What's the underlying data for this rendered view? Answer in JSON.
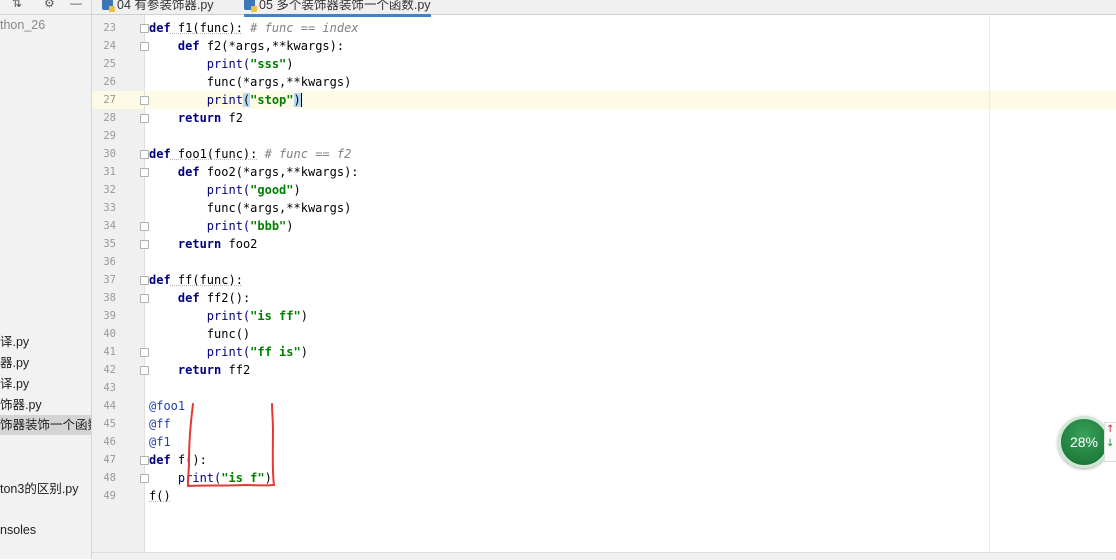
{
  "sidebar": {
    "root_label": "thon_26",
    "items": [
      {
        "label": "译.py",
        "selected": false
      },
      {
        "label": "器.py",
        "selected": false
      },
      {
        "label": "译.py",
        "selected": false
      },
      {
        "label": "饰器.py",
        "selected": false
      },
      {
        "label": "饰器装饰一个函数",
        "selected": true
      },
      {
        "label": "ton3的区别.py",
        "selected": false
      },
      {
        "label": "nsoles",
        "selected": false
      }
    ]
  },
  "tabs": [
    {
      "label": "04 有参装饰器.py",
      "active": false
    },
    {
      "label": "05 多个装饰器装饰一个函数.py",
      "active": true
    }
  ],
  "editor": {
    "line_numbers": [
      "23",
      "24",
      "25",
      "26",
      "27",
      "28",
      "29",
      "30",
      "31",
      "32",
      "33",
      "34",
      "35",
      "36",
      "37",
      "38",
      "39",
      "40",
      "41",
      "42",
      "43",
      "44",
      "45",
      "46",
      "47",
      "48",
      "49"
    ],
    "current_line": "27"
  },
  "code": {
    "l23_def": "def",
    "l23_sig": " f1(func):",
    "l23_cmt": " # func == index",
    "l24_def": "def",
    "l24_sig": " f2(*args,**kwargs):",
    "l25_print": "print(",
    "l25_str": "\"sss\"",
    "l25_close": ")",
    "l26": "func(*args,**kwargs)",
    "l27_print": "print",
    "l27_open": "(",
    "l27_str": "\"stop\"",
    "l27_close": ")",
    "l28_ret": "return",
    "l28_val": " f2",
    "l30_def": "def",
    "l30_sig": " foo1(func):",
    "l30_cmt": " # func == f2",
    "l31_def": "def",
    "l31_sig": " foo2(*args,**kwargs):",
    "l32_print": "print(",
    "l32_str": "\"good\"",
    "l32_close": ")",
    "l33": "func(*args,**kwargs)",
    "l34_print": "print(",
    "l34_str": "\"bbb\"",
    "l34_close": ")",
    "l35_ret": "return",
    "l35_val": " foo2",
    "l37_def": "def",
    "l37_sig": " ff(func):",
    "l38_def": "def",
    "l38_sig": " ff2():",
    "l39_print": "print(",
    "l39_str": "\"is ff\"",
    "l39_close": ")",
    "l40": "func()",
    "l41_print": "print(",
    "l41_str": "\"ff is\"",
    "l41_close": ")",
    "l42_ret": "return",
    "l42_val": " ff2",
    "l44": "@foo1",
    "l45": "@ff",
    "l46": "@f1",
    "l47_def": "def",
    "l47_sig": " f():",
    "l48_print": "print(",
    "l48_str": "\"is f\"",
    "l48_close": ")",
    "l49": "f()"
  },
  "status": {
    "memory_percent": "28%",
    "net_up_icon": "↑",
    "net_down_icon": "↓"
  },
  "colors": {
    "keyword": "#000080",
    "string": "#008000",
    "comment": "#808080",
    "caret_line": "#fdfbe5",
    "annotation_red": "#e53935"
  }
}
